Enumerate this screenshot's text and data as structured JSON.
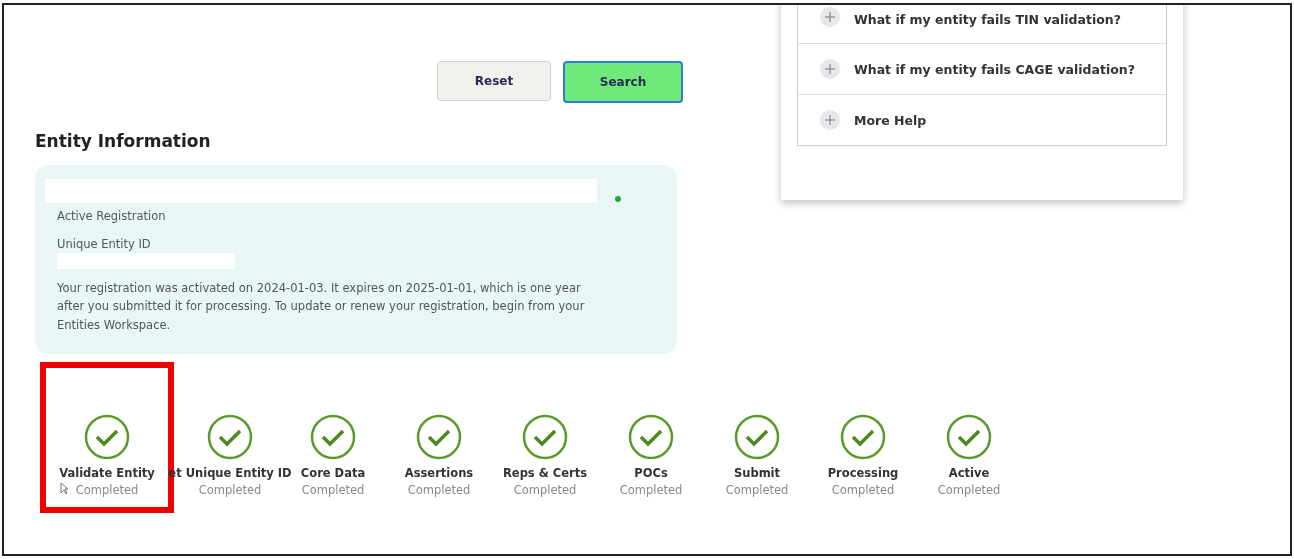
{
  "buttons": [
    {
      "label": "Reset",
      "kind": "secondary"
    },
    {
      "label": "Search",
      "kind": "primary"
    }
  ],
  "entity_information": {
    "heading": "Entity Information",
    "status": "Active Registration",
    "id_label": "Unique Entity ID",
    "message": "Your registration was activated on 2024-01-03. It expires on 2025-01-01, which is one year after you submitted it for processing. To update or renew your registration, begin from your Entities Workspace."
  },
  "help_items": [
    {
      "label": "What if my entity fails TIN validation?",
      "expanded": false
    },
    {
      "label": "What if my entity fails CAGE validation?",
      "expanded": false
    },
    {
      "label": "More Help",
      "expanded": false
    }
  ],
  "steps": [
    {
      "label": "Validate Entity",
      "status": "Completed",
      "highlighted": true
    },
    {
      "label": "et Unique Entity ID",
      "status": "Completed",
      "highlighted": false
    },
    {
      "label": "Core Data",
      "status": "Completed",
      "highlighted": false
    },
    {
      "label": "Assertions",
      "status": "Completed",
      "highlighted": false
    },
    {
      "label": "Reps & Certs",
      "status": "Completed",
      "highlighted": false
    },
    {
      "label": "POCs",
      "status": "Completed",
      "highlighted": false
    },
    {
      "label": "Submit",
      "status": "Completed",
      "highlighted": false
    },
    {
      "label": "Processing",
      "status": "Completed",
      "highlighted": false
    },
    {
      "label": "Active",
      "status": "Completed",
      "highlighted": false
    }
  ]
}
